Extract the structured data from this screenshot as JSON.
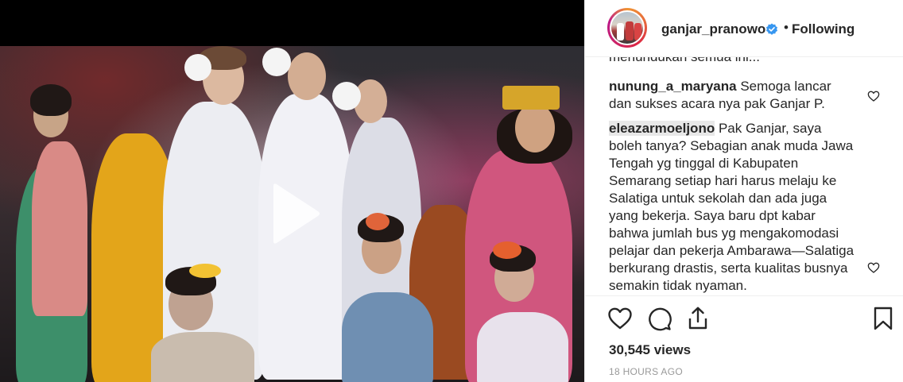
{
  "post": {
    "username": "ganjar_pranowo",
    "separator": "•",
    "follow_status": "Following",
    "views": "30,545 views",
    "timestamp": "18 HOURS AGO"
  },
  "comments": {
    "truncated_text": "menundukan semua ini...",
    "items": [
      {
        "user": "nunung_a_maryana",
        "text": "Semoga lancar dan sukses acara nya pak Ganjar P."
      },
      {
        "user": "eleazarmoeljono",
        "text": "Pak Ganjar, saya boleh tanya? Sebagian anak muda Jawa Tengah yg tinggal di Kabupaten Semarang setiap hari harus melaju ke Salatiga untuk sekolah dan ada juga yang bekerja. Saya baru dpt kabar bahwa jumlah bus yg mengakomodasi pelajar dan pekerja Ambarawa—Salatiga berkurang drastis, serta kualitas busnya semakin tidak nyaman."
      }
    ]
  },
  "icons": {
    "play": "play-icon",
    "verified": "verified-badge-icon",
    "like": "heart-icon",
    "comment": "comment-bubble-icon",
    "share": "share-icon",
    "save": "bookmark-icon"
  },
  "colors": {
    "verified": "#3897f0",
    "text": "#262626",
    "muted": "#999999",
    "border": "#efefef"
  }
}
